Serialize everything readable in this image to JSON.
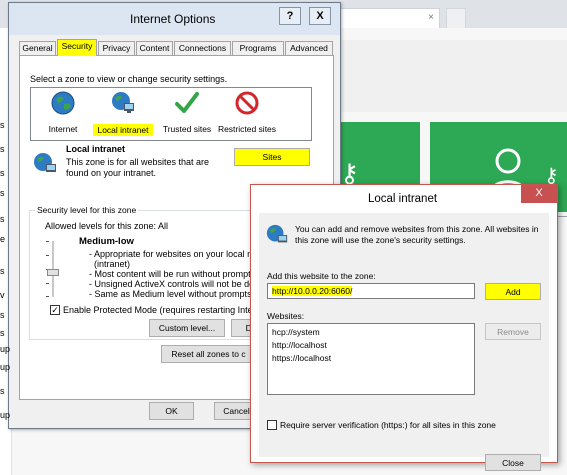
{
  "browser": {
    "tab_close_glyph": "×",
    "sidebar_letters": [
      "s",
      "s",
      "s",
      "s",
      "s",
      "e",
      "s",
      "v",
      "s",
      "s",
      "up",
      "up",
      "s",
      "up"
    ]
  },
  "internet_options": {
    "title": "Internet Options",
    "help_label": "?",
    "close_label": "X",
    "tabs": [
      "General",
      "Security",
      "Privacy",
      "Content",
      "Connections",
      "Programs",
      "Advanced"
    ],
    "selected_tab": "Security",
    "zone_prompt": "Select a zone to view or change security settings.",
    "zones": [
      {
        "label": "Internet",
        "icon": "globe-icon"
      },
      {
        "label": "Local intranet",
        "icon": "intranet-icon"
      },
      {
        "label": "Trusted sites",
        "icon": "checkmark-icon"
      },
      {
        "label": "Restricted sites",
        "icon": "restricted-icon"
      }
    ],
    "zone_title": "Local intranet",
    "zone_description": "This zone is for all websites that are found on your intranet.",
    "sites_button": "Sites",
    "security_level_group": "Security level for this zone",
    "allowed_levels": "Allowed levels for this zone: All",
    "level_name": "Medium-low",
    "level_bullets": [
      "- Appropriate for websites on your local ne",
      "(intranet)",
      "- Most content will be run without promptin",
      "- Unsigned ActiveX controls will not be dow",
      "- Same as Medium level without prompts"
    ],
    "protected_mode_label": "Enable Protected Mode (requires restarting Intern",
    "protected_mode_checked": "✓",
    "custom_level_button": "Custom level...",
    "default_level_button": "De",
    "reset_all_button": "Reset all zones to c",
    "ok_button": "OK",
    "cancel_button": "Cancel"
  },
  "local_intranet": {
    "title": "Local intranet",
    "close_label": "X",
    "info": "You can add and remove websites from this zone. All websites in this zone will use the zone's security settings.",
    "add_label": "Add this website to the zone:",
    "add_value": "http://10.0.0.20:6060/",
    "add_button": "Add",
    "websites_label": "Websites:",
    "websites": [
      "hcp://system",
      "http://localhost",
      "https://localhost"
    ],
    "remove_button": "Remove",
    "require_https_label": "Require server verification (https:) for all sites in this zone",
    "close_button": "Close"
  },
  "colors": {
    "highlight": "#ffff00",
    "tile_green": "#2da854",
    "close_red": "#c75050",
    "title_blue": "#dbe6f2"
  }
}
